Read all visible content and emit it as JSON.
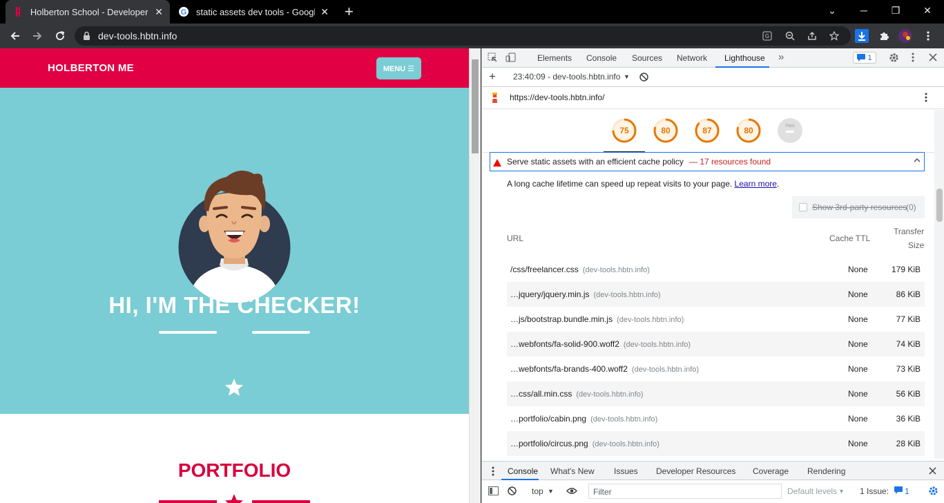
{
  "browser": {
    "tabs": [
      {
        "title": "Holberton School - Developer to",
        "close": "✕"
      },
      {
        "title": "static assets dev tools - Google S",
        "close": "✕"
      }
    ],
    "new_tab": "+",
    "window_controls": [
      "⌄",
      "─",
      "❐",
      "✕"
    ],
    "address": "dev-tools.hbtn.info"
  },
  "site": {
    "brand": "HOLBERTON ME",
    "menu_label": "MENU ☰",
    "hero_title": "HI, I'M THE CHECKER!",
    "portfolio_title": "PORTFOLIO"
  },
  "devtools": {
    "tabs": [
      "Elements",
      "Console",
      "Sources",
      "Network",
      "Lighthouse"
    ],
    "more": "»",
    "issues_badge": "1",
    "report_label": "23:40:09 - dev-tools.hbtn.info",
    "page_url": "https://dev-tools.hbtn.info/",
    "scores": [
      {
        "value": 75,
        "label": "75"
      },
      {
        "value": 80,
        "label": "80"
      },
      {
        "value": 87,
        "label": "87"
      },
      {
        "value": 80,
        "label": "80"
      }
    ],
    "pwa_label": "PWA",
    "audit": {
      "title": "Serve static assets with an efficient cache policy",
      "summary": "— 17 resources found",
      "description": "A long cache lifetime can speed up repeat visits to your page.",
      "learn_more": "Learn more",
      "period": ".",
      "third_party_label": "Show 3rd-party resources",
      "third_party_count": "(0)",
      "columns": {
        "url": "URL",
        "ttl": "Cache TTL",
        "size_line1": "Transfer",
        "size_line2": "Size"
      },
      "rows": [
        {
          "path": "/css/freelancer.css",
          "host": "(dev-tools.hbtn.info)",
          "ttl": "None",
          "size": "179 KiB"
        },
        {
          "path": "…jquery/jquery.min.js",
          "host": "(dev-tools.hbtn.info)",
          "ttl": "None",
          "size": "86 KiB"
        },
        {
          "path": "…js/bootstrap.bundle.min.js",
          "host": "(dev-tools.hbtn.info)",
          "ttl": "None",
          "size": "77 KiB"
        },
        {
          "path": "…webfonts/fa-solid-900.woff2",
          "host": "(dev-tools.hbtn.info)",
          "ttl": "None",
          "size": "74 KiB"
        },
        {
          "path": "…webfonts/fa-brands-400.woff2",
          "host": "(dev-tools.hbtn.info)",
          "ttl": "None",
          "size": "73 KiB"
        },
        {
          "path": "…css/all.min.css",
          "host": "(dev-tools.hbtn.info)",
          "ttl": "None",
          "size": "56 KiB"
        },
        {
          "path": "…portfolio/cabin.png",
          "host": "(dev-tools.hbtn.info)",
          "ttl": "None",
          "size": "36 KiB"
        },
        {
          "path": "…portfolio/circus.png",
          "host": "(dev-tools.hbtn.info)",
          "ttl": "None",
          "size": "28 KiB"
        }
      ]
    },
    "drawer_tabs": [
      "Console",
      "What's New",
      "Issues",
      "Developer Resources",
      "Coverage",
      "Rendering"
    ],
    "console": {
      "context": "top",
      "filter_placeholder": "Filter",
      "levels": "Default levels",
      "issues": "1 Issue:",
      "issues_count": "1"
    }
  },
  "colors": {
    "brand_red": "#e10043",
    "hero_teal": "#7acdd4",
    "score_orange": "#e67700"
  },
  "icons": [
    "back-icon",
    "forward-icon",
    "reload-icon",
    "lock-icon",
    "translate-icon",
    "zoom-icon",
    "share-icon",
    "star-icon",
    "download-icon",
    "extensions-icon",
    "more-icon",
    "inspect-icon",
    "device-icon",
    "gear-icon",
    "lighthouse-icon",
    "warning-icon",
    "eye-icon",
    "block-icon"
  ]
}
